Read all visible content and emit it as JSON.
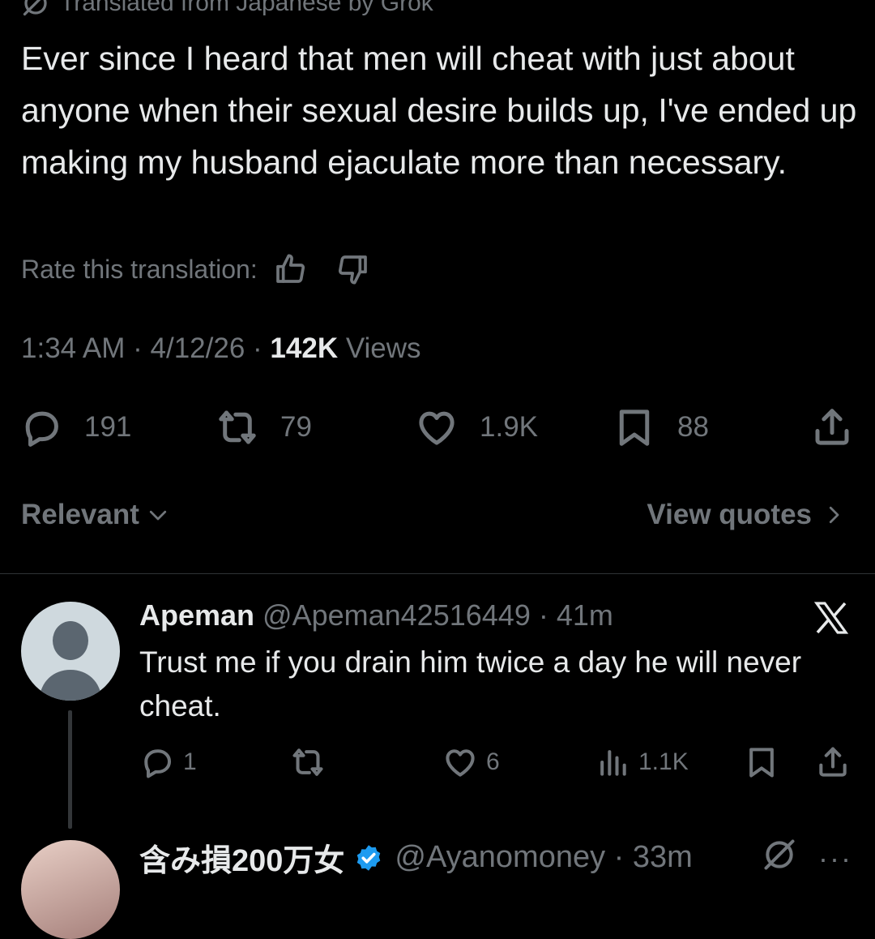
{
  "translation_header": {
    "label": "Translated from Japanese by Grok",
    "icon": "grok-icon"
  },
  "tweet": {
    "text": "Ever since I heard that men will cheat with just about anyone when their sexual desire builds up, I've ended up making my husband ejaculate more than necessary.",
    "rate_label": "Rate this translation:",
    "time": "1:34 AM",
    "sep1": " · ",
    "date": "4/12/26",
    "sep2": " · ",
    "views_count": "142K",
    "views_label": " Views",
    "actions": {
      "replies": "191",
      "reposts": "79",
      "likes": "1.9K",
      "bookmarks": "88"
    }
  },
  "sort": {
    "label": "Relevant",
    "icon": "chevron-down-icon"
  },
  "quotes": {
    "label": "View quotes",
    "icon": "chevron-right-icon"
  },
  "reply": {
    "name": "Apeman",
    "handle_time": " @Apeman42516449 · 41m",
    "text": "Trust me if you drain him twice a day he will never cheat.",
    "actions": {
      "replies": "1",
      "reposts": "",
      "likes": "6",
      "views": "1.1K"
    },
    "badge_icon": "x-logo-icon"
  },
  "reply2": {
    "name": "含み損200万女",
    "handle_time": "@Ayanomoney · 33m",
    "more": "···"
  },
  "colors": {
    "background": "#000000",
    "text": "#e7e9ea",
    "muted": "#71767b",
    "verified": "#1d9bf0",
    "divider": "#2f3336"
  }
}
